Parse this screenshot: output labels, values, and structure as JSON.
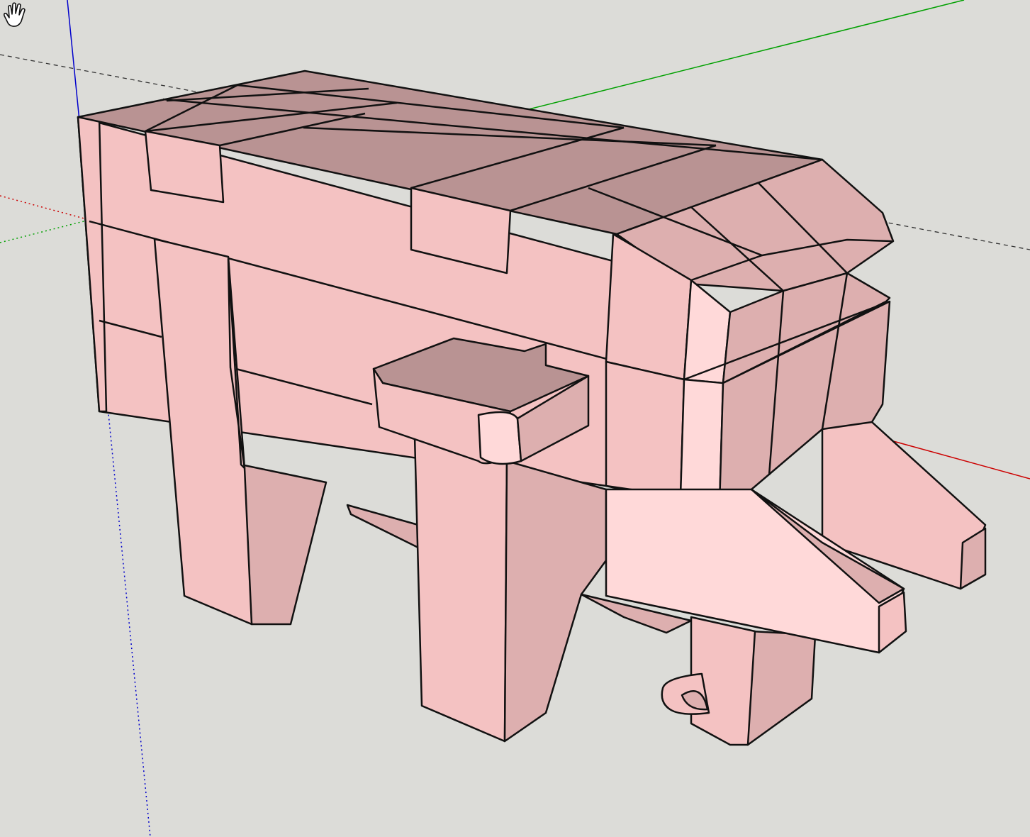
{
  "app": {
    "name": "",
    "active_tool": "pan-tool"
  },
  "viewport": {
    "background": "#dcdcd8",
    "axes": {
      "red": "#cc0000",
      "green": "#00a000",
      "blue": "#0000cc",
      "guide": "#333333"
    },
    "model": {
      "name": "",
      "material_color": "#f4c2c2",
      "shade_light": "#ffd9d9",
      "shade_mid": "#f2bcbc",
      "shade_side": "#ddafaf",
      "shade_top": "#b99393",
      "edge_color": "#111111"
    }
  },
  "icons": {
    "cursor": "pan-hand-icon"
  }
}
